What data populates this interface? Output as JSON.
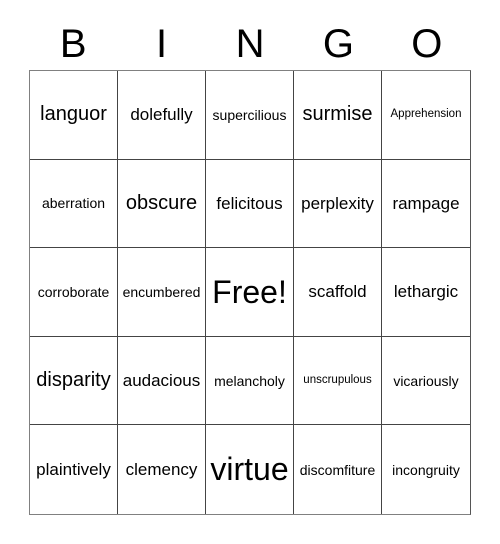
{
  "card": {
    "title_letters": [
      "B",
      "I",
      "N",
      "G",
      "O"
    ],
    "free_space": "Free!",
    "rows": [
      [
        {
          "text": "languor",
          "size": "fs-lg"
        },
        {
          "text": "dolefully",
          "size": "fs-md"
        },
        {
          "text": "supercilious",
          "size": "fs-sm"
        },
        {
          "text": "surmise",
          "size": "fs-lg"
        },
        {
          "text": "Apprehension",
          "size": "fs-xs"
        }
      ],
      [
        {
          "text": "aberration",
          "size": "fs-sm"
        },
        {
          "text": "obscure",
          "size": "fs-lg"
        },
        {
          "text": "felicitous",
          "size": "fs-md"
        },
        {
          "text": "perplexity",
          "size": "fs-md"
        },
        {
          "text": "rampage",
          "size": "fs-md"
        }
      ],
      [
        {
          "text": "corroborate",
          "size": "fs-sm"
        },
        {
          "text": "encumbered",
          "size": "fs-sm"
        },
        {
          "text": "Free!",
          "size": "fs-xl"
        },
        {
          "text": "scaffold",
          "size": "fs-md"
        },
        {
          "text": "lethargic",
          "size": "fs-md"
        }
      ],
      [
        {
          "text": "disparity",
          "size": "fs-lg"
        },
        {
          "text": "audacious",
          "size": "fs-md"
        },
        {
          "text": "melancholy",
          "size": "fs-sm"
        },
        {
          "text": "unscrupulous",
          "size": "fs-xs"
        },
        {
          "text": "vicariously",
          "size": "fs-sm"
        }
      ],
      [
        {
          "text": "plaintively",
          "size": "fs-md"
        },
        {
          "text": "clemency",
          "size": "fs-md"
        },
        {
          "text": "virtue",
          "size": "fs-xl"
        },
        {
          "text": "discomfiture",
          "size": "fs-sm"
        },
        {
          "text": "incongruity",
          "size": "fs-sm"
        }
      ]
    ]
  }
}
